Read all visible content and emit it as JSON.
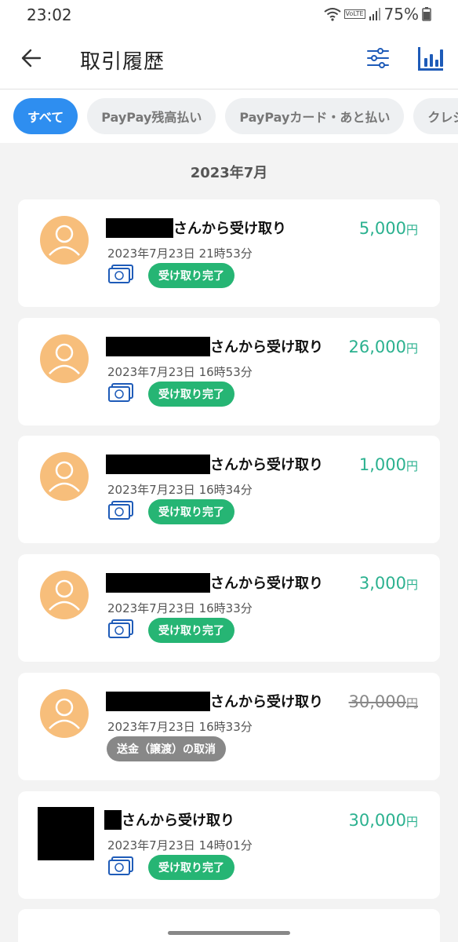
{
  "status_bar": {
    "time": "23:02",
    "battery": "75%",
    "network_label": "VoLTE"
  },
  "app_bar": {
    "title": "取引履歴",
    "back_icon": "arrow-left-icon",
    "filter_icon": "sliders-icon",
    "chart_icon": "bar-chart-icon"
  },
  "tabs": [
    {
      "label": "すべて",
      "active": true
    },
    {
      "label": "PayPay残高払い",
      "active": false
    },
    {
      "label": "PayPayカード・あと払い",
      "active": false
    },
    {
      "label": "クレジット",
      "active": false
    }
  ],
  "month": "2023年7月",
  "transactions": [
    {
      "name_suffix": "さんから受け取り",
      "date": "2023年7月23日 21時53分",
      "amount": "5,000",
      "currency": "円",
      "badge": "受け取り完了",
      "cancelled": false
    },
    {
      "name_suffix": "さんから受け取り",
      "date": "2023年7月23日 16時53分",
      "amount": "26,000",
      "currency": "円",
      "badge": "受け取り完了",
      "cancelled": false
    },
    {
      "name_suffix": "さんから受け取り",
      "date": "2023年7月23日 16時34分",
      "amount": "1,000",
      "currency": "円",
      "badge": "受け取り完了",
      "cancelled": false
    },
    {
      "name_suffix": "さんから受け取り",
      "date": "2023年7月23日 16時33分",
      "amount": "3,000",
      "currency": "円",
      "badge": "受け取り完了",
      "cancelled": false
    },
    {
      "name_suffix": "さんから受け取り",
      "date": "2023年7月23日 16時33分",
      "amount": "30,000",
      "currency": "円",
      "badge": "送金（譲渡）の取消",
      "cancelled": true
    },
    {
      "name_suffix": "さんから受け取り",
      "date": "2023年7月23日 14時01分",
      "amount": "30,000",
      "currency": "円",
      "badge": "受け取り完了",
      "cancelled": false
    }
  ],
  "colors": {
    "accent": "#2e8ef0",
    "amount_green": "#2bb18f",
    "badge_green": "#26b574",
    "avatar_orange": "#f7be7b"
  }
}
